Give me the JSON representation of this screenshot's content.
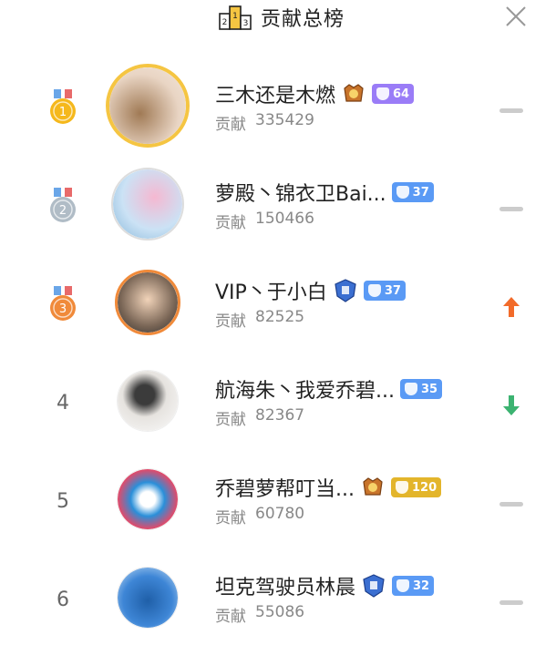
{
  "header": {
    "title": "贡献总榜",
    "podium_digits": [
      "2",
      "1",
      "3"
    ]
  },
  "contrib_label": "贡献",
  "rows": [
    {
      "rank": "1",
      "name": "三木还是木燃",
      "score": "335429",
      "badge_level": "64",
      "badge_color": "#9a7cf7",
      "crest": "crown",
      "trend": "same"
    },
    {
      "rank": "2",
      "name": "萝殿丶锦衣卫Bai...",
      "score": "150466",
      "badge_level": "37",
      "badge_color": "#5a9af5",
      "crest": "",
      "trend": "same"
    },
    {
      "rank": "3",
      "name": "VIP丶于小白",
      "score": "82525",
      "badge_level": "37",
      "badge_color": "#5a9af5",
      "crest": "guard",
      "trend": "up"
    },
    {
      "rank": "4",
      "name": "航海朱丶我爱乔碧...",
      "score": "82367",
      "badge_level": "35",
      "badge_color": "#5a9af5",
      "crest": "",
      "trend": "down"
    },
    {
      "rank": "5",
      "name": "乔碧萝帮叮当...",
      "score": "60780",
      "badge_level": "120",
      "badge_color": "#e3b52b",
      "crest": "crown",
      "trend": "same"
    },
    {
      "rank": "6",
      "name": "坦克驾驶员林晨",
      "score": "55086",
      "badge_level": "32",
      "badge_color": "#5a9af5",
      "crest": "guard",
      "trend": "same"
    }
  ],
  "colors": {
    "trend_up": "#f26b2a",
    "trend_down": "#3cb371",
    "trend_same": "#cccccc",
    "medal_gold": "#f5b81c",
    "medal_silver": "#b0bcc6",
    "medal_bronze": "#f08a3a"
  }
}
